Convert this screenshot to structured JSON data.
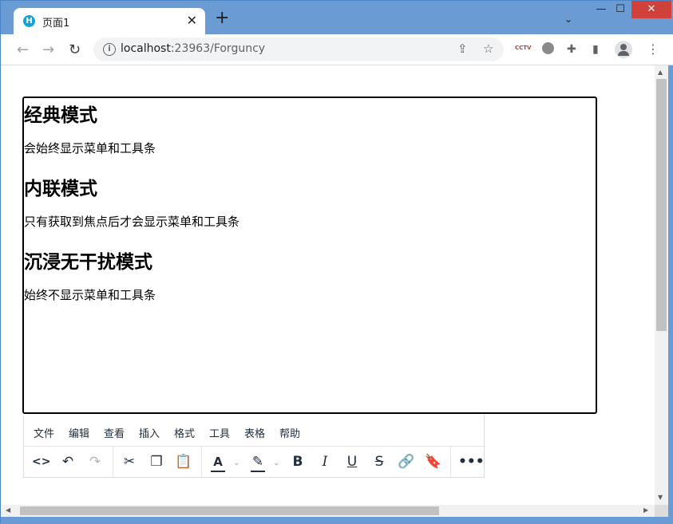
{
  "browser": {
    "tab_title": "页面1",
    "tab_favicon_letter": "H",
    "url_host": "localhost",
    "url_path": ":23963/Forguncy",
    "ext_cctv_label": "CCTV"
  },
  "editor": {
    "sections": [
      {
        "heading": "经典模式",
        "text": "会始终显示菜单和工具条"
      },
      {
        "heading": "内联模式",
        "text": "只有获取到焦点后才会显示菜单和工具条"
      },
      {
        "heading": "沉浸无干扰模式",
        "text": "始终不显示菜单和工具条"
      }
    ],
    "menu": [
      "文件",
      "编辑",
      "查看",
      "插入",
      "格式",
      "工具",
      "表格",
      "帮助"
    ]
  },
  "icons": {
    "back": "arrow-left-icon",
    "forward": "arrow-right-icon",
    "reload": "reload-icon",
    "share": "share-icon",
    "star": "star-icon",
    "puzzle": "extension-icon",
    "sidepanel": "side-panel-icon",
    "menu": "kebab-menu-icon"
  },
  "colors": {
    "chrome_frame": "#6a9bd3",
    "close_button": "#d0413b",
    "editor_border": "#000000",
    "toolbar_text": "#222f3e"
  }
}
